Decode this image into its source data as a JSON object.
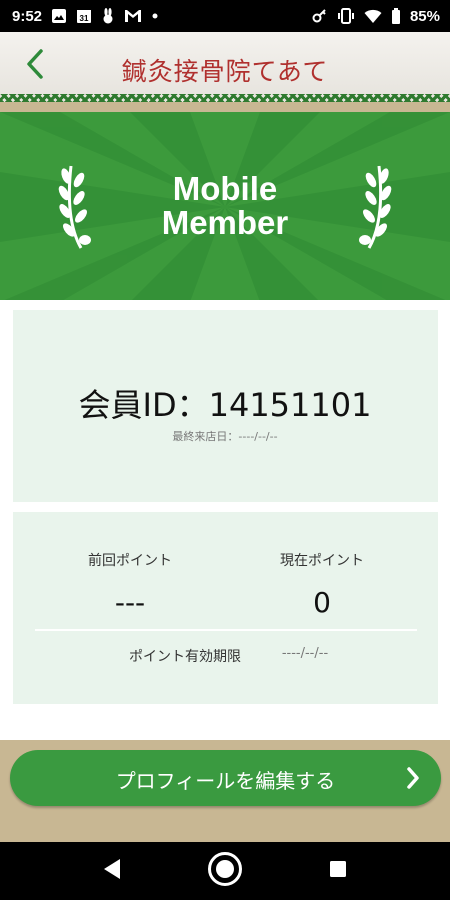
{
  "status_bar": {
    "time": "9:52",
    "battery": "85%",
    "left_icons": [
      "image-icon",
      "calendar-icon",
      "rabbit-icon",
      "gmail-icon",
      "dot-icon"
    ],
    "right_icons": [
      "key-icon",
      "vibrate-icon",
      "wifi-icon",
      "battery-icon"
    ]
  },
  "app_bar": {
    "title": "鍼灸接骨院てあて",
    "back_icon": "chevron-left-icon",
    "accent_color": "#2e8a3a",
    "title_color": "#b0302e"
  },
  "banner": {
    "line1": "Mobile",
    "line2": "Member",
    "background": "#3c9a3c",
    "icon": "laurel-icon"
  },
  "member": {
    "id_text": "会員ID：14151101",
    "last_visit": "最終来店日：----/--/--"
  },
  "points": {
    "previous_label": "前回ポイント",
    "previous_value": "---",
    "current_label": "現在ポイント",
    "current_value": "0",
    "expiry_label": "ポイント有効期限",
    "expiry_value": "----/--/--"
  },
  "edit_profile": {
    "label": "プロフィールを編集する",
    "icon": "chevron-right-icon",
    "color": "#3a9a40"
  },
  "nav_bar": {
    "icons": [
      "back-triangle-icon",
      "home-circle-icon",
      "recents-square-icon"
    ]
  }
}
